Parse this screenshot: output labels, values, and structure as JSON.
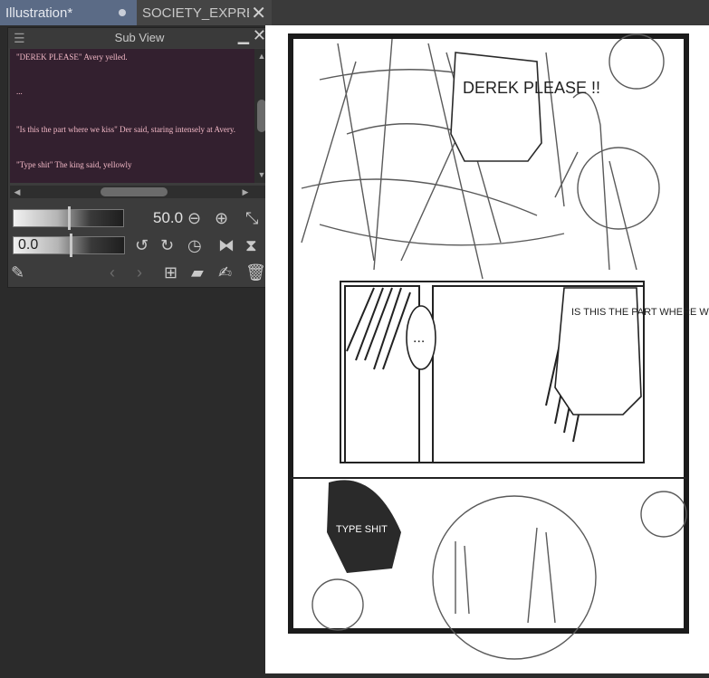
{
  "tabs": [
    {
      "label": "Illustration*",
      "state": "modified"
    },
    {
      "label": "SOCIETY_EXPRES",
      "state": "closable"
    }
  ],
  "subview": {
    "title": "Sub View",
    "lines": [
      "\"DEREK PLEASE\" Avery yelled.",
      "...",
      "\"Is this the part where we kiss\" Der said, staring intensely at Avery.",
      "\"Type shit\" The king said, yellowly"
    ]
  },
  "controls": {
    "zoom_value": "50.0",
    "angle_value": "0.0"
  },
  "canvas": {
    "speech_derek": "DEREK PLEASE !!",
    "speech_kiss": "IS THIS THE PART WHERE WE KISS",
    "dots": "...",
    "type_shit": "TYPE SHIT"
  },
  "colors": {
    "tab_active": "#5b6b86",
    "text_bg": "#33202f",
    "text_fg": "#f2b8c6"
  }
}
